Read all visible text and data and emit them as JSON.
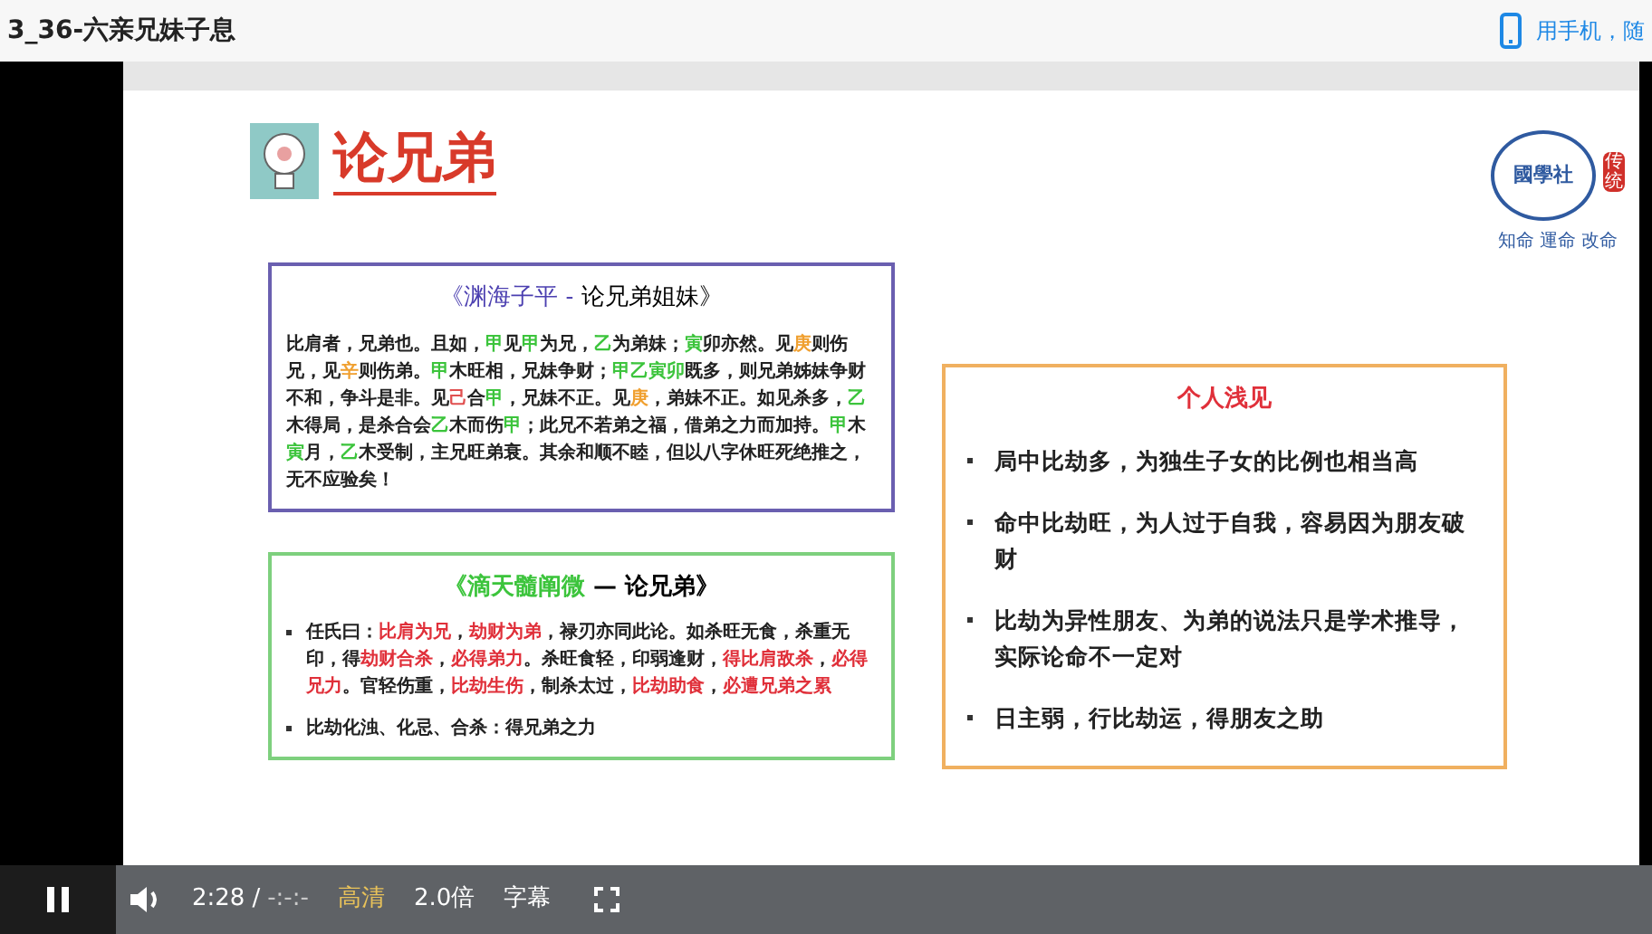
{
  "page_title": "3_36-六亲兄妹子息",
  "mobile_link": "用手机，随",
  "slide": {
    "heading": "论兄弟",
    "logo": {
      "name": "國學社",
      "seal": "传统",
      "motto": "知命 運命 改命"
    },
    "quote_box": {
      "title_segments": [
        {
          "text": "《渊海子平 - ",
          "color": "#4b3fb0"
        },
        {
          "text": "论兄弟姐妹》"
        }
      ],
      "body_segments": [
        {
          "text": "比肩者，兄弟也。且如，"
        },
        {
          "text": "甲",
          "color": "#3cc43c"
        },
        {
          "text": "见"
        },
        {
          "text": "甲",
          "color": "#3cc43c"
        },
        {
          "text": "为兄，"
        },
        {
          "text": "乙",
          "color": "#3cc43c"
        },
        {
          "text": "为弟妹；"
        },
        {
          "text": "寅",
          "color": "#3cc43c"
        },
        {
          "text": "卯亦然。见"
        },
        {
          "text": "庚",
          "color": "#f0a030"
        },
        {
          "text": "则伤兄，见"
        },
        {
          "text": "辛",
          "color": "#f0a030"
        },
        {
          "text": "则伤弟。"
        },
        {
          "text": "甲",
          "color": "#3cc43c"
        },
        {
          "text": "木旺相，兄妹争财；"
        },
        {
          "text": "甲乙寅卯",
          "color": "#3cc43c"
        },
        {
          "text": "既多，则兄弟姊妹争财不和，争斗是非。见"
        },
        {
          "text": "己",
          "color": "#e05050"
        },
        {
          "text": "合"
        },
        {
          "text": "甲",
          "color": "#3cc43c"
        },
        {
          "text": "，兄妹不正。见"
        },
        {
          "text": "庚",
          "color": "#f0a030"
        },
        {
          "text": "，弟妹不正。如见杀多，"
        },
        {
          "text": "乙",
          "color": "#3cc43c"
        },
        {
          "text": "木得局，是杀合会"
        },
        {
          "text": "乙",
          "color": "#3cc43c"
        },
        {
          "text": "木而伤"
        },
        {
          "text": "甲",
          "color": "#3cc43c"
        },
        {
          "text": "；此兄不若弟之福，借弟之力而加持。"
        },
        {
          "text": "甲",
          "color": "#3cc43c"
        },
        {
          "text": "木"
        },
        {
          "text": "寅",
          "color": "#3cc43c"
        },
        {
          "text": "月，"
        },
        {
          "text": "乙",
          "color": "#3cc43c"
        },
        {
          "text": "木受制，主兄旺弟衰。其余和顺不睦，但以八字休旺死绝推之，无不应验矣！"
        }
      ]
    },
    "commentary_box": {
      "title_segments": [
        {
          "text": "《滴天髓阐微",
          "color": "#3cc43c"
        },
        {
          "text": " — 论兄弟》"
        }
      ],
      "bullets": [
        {
          "segments": [
            {
              "text": "任氏曰："
            },
            {
              "text": "比肩为兄",
              "color": "#e0303a"
            },
            {
              "text": "，"
            },
            {
              "text": "劫财为弟",
              "color": "#e0303a"
            },
            {
              "text": "，禄刃亦同此论。如杀旺无食，杀重无印，得"
            },
            {
              "text": "劫财合杀",
              "color": "#e0303a"
            },
            {
              "text": "，"
            },
            {
              "text": "必得弟力",
              "color": "#e0303a"
            },
            {
              "text": "。杀旺食轻，印弱逢财，"
            },
            {
              "text": "得比肩敌杀",
              "color": "#e0303a"
            },
            {
              "text": "，"
            },
            {
              "text": "必得兄力",
              "color": "#e0303a"
            },
            {
              "text": "。官轻伤重，"
            },
            {
              "text": "比劫生伤",
              "color": "#e0303a"
            },
            {
              "text": "，制杀太过，"
            },
            {
              "text": "比劫助食",
              "color": "#e0303a"
            },
            {
              "text": "，"
            },
            {
              "text": "必遭兄弟之累",
              "color": "#e0303a"
            }
          ]
        },
        {
          "segments": [
            {
              "text": "比劫化浊、化忌、合杀：得兄弟之力"
            }
          ]
        }
      ]
    },
    "opinion_box": {
      "title": "个人浅见",
      "bullets": [
        "局中比劫多，为独生子女的比例也相当高",
        "命中比劫旺，为人过于自我，容易因为朋友破财",
        "比劫为异性朋友、为弟的说法只是学术推导，实际论命不一定对",
        "日主弱，行比劫运，得朋友之助"
      ]
    }
  },
  "player": {
    "playing": true,
    "current_time": "2:28",
    "separator": "/",
    "duration": "-:-:-",
    "quality": "高清",
    "speed": "2.0倍",
    "subtitles": "字幕"
  }
}
